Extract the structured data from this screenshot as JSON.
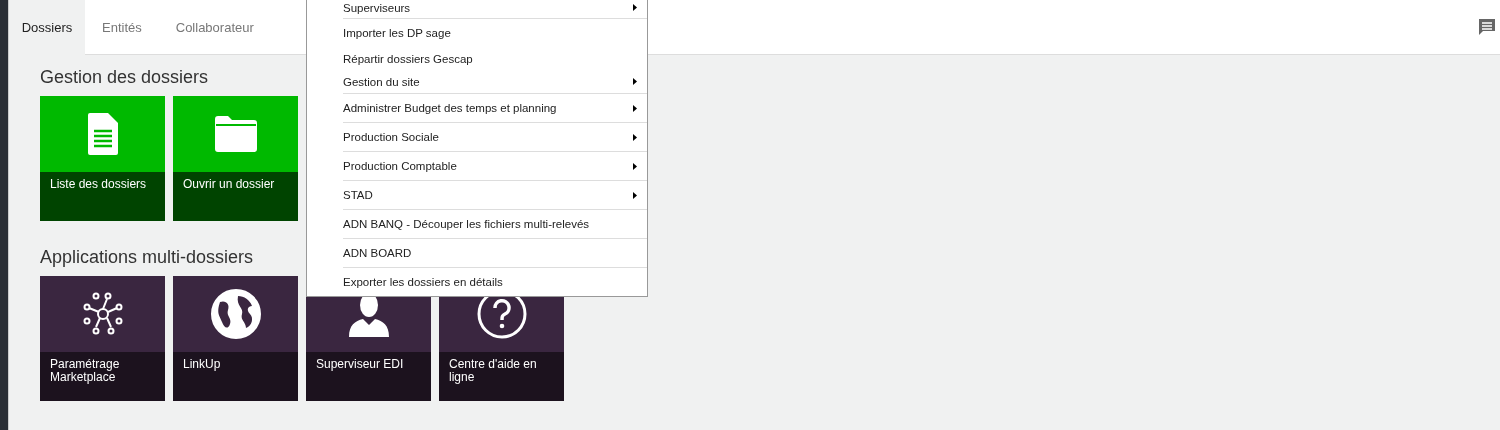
{
  "tabs": [
    {
      "label": "Dossiers",
      "selected": true
    },
    {
      "label": "Entités",
      "selected": false
    },
    {
      "label": "Collaborateur",
      "selected": false
    }
  ],
  "sections": [
    {
      "title": "Gestion des dossiers",
      "tiles": [
        {
          "label": "Liste des dossiers"
        },
        {
          "label": "Ouvrir un dossier"
        }
      ]
    },
    {
      "title": "Applications multi-dossiers",
      "tiles": [
        {
          "label": "Paramétrage Marketplace"
        },
        {
          "label": "LinkUp"
        },
        {
          "label": "Superviseur EDI"
        },
        {
          "label": "Centre d'aide en ligne"
        }
      ]
    }
  ],
  "menu": {
    "items": [
      {
        "label": "Superviseurs",
        "has_submenu": true,
        "separator_before": false
      },
      {
        "label": "Importer les DP sage",
        "has_submenu": false,
        "separator_before": true
      },
      {
        "label": "Répartir dossiers Gescap",
        "has_submenu": false,
        "separator_before": false
      },
      {
        "label": "Gestion du site",
        "has_submenu": true,
        "separator_before": false
      },
      {
        "label": "Administrer Budget des temps et planning",
        "has_submenu": true,
        "separator_before": true
      },
      {
        "label": "Production Sociale",
        "has_submenu": true,
        "separator_before": true
      },
      {
        "label": "Production Comptable",
        "has_submenu": true,
        "separator_before": true
      },
      {
        "label": "STAD",
        "has_submenu": true,
        "separator_before": true
      },
      {
        "label": "ADN BANQ - Découper les fichiers multi-relevés",
        "has_submenu": false,
        "separator_before": true
      },
      {
        "label": "ADN BOARD",
        "has_submenu": false,
        "separator_before": true
      },
      {
        "label": "Exporter les dossiers en détails",
        "has_submenu": false,
        "separator_before": true
      }
    ]
  }
}
